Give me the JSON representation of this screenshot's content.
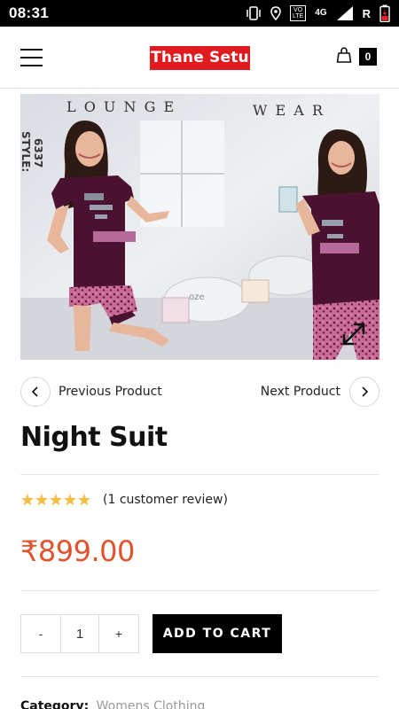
{
  "status_bar": {
    "time": "08:31",
    "volte_top": "VO",
    "volte_bottom": "LTE",
    "network": "4G",
    "roaming": "R"
  },
  "header": {
    "logo_text": "Thane Setu",
    "cart_count": "0"
  },
  "product_image": {
    "headline_left": "L O U N G E",
    "headline_right": "W E A R",
    "style_text": "STYLE:",
    "style_number": "6337",
    "pillow_text": "oze",
    "colors": {
      "garment": "#4a1230",
      "shorts": "#c86a95",
      "background": "#e9eaee"
    }
  },
  "nav": {
    "previous_label": "Previous Product",
    "next_label": "Next Product"
  },
  "product": {
    "title": "Night Suit",
    "rating": 5,
    "rating_max": 5,
    "review_text": "(1 customer review)",
    "price": "₹899.00",
    "quantity": "1",
    "minus_label": "-",
    "plus_label": "+",
    "add_to_cart_label": "ADD TO CART",
    "category_label": "Category:",
    "category_value": "Womens Clothing"
  },
  "colors": {
    "accent_price": "#e2532d",
    "logo_bg": "#e01a1f",
    "star": "#f2c04a"
  }
}
